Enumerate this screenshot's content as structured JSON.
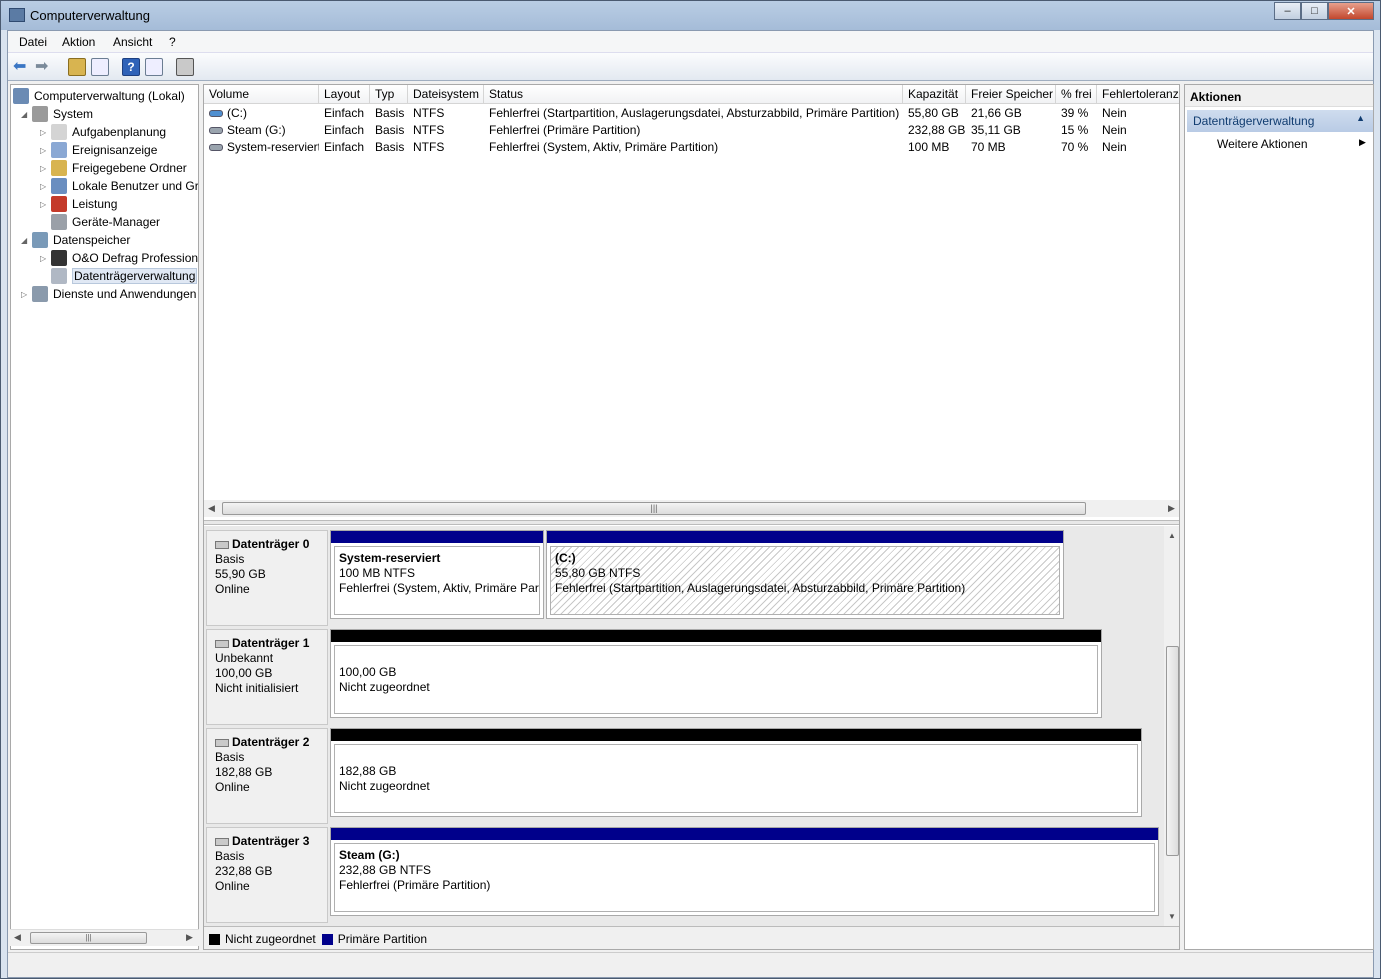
{
  "window": {
    "title": "Computerverwaltung",
    "minimize": "–",
    "maximize": "□",
    "close": "✕"
  },
  "menu": [
    "Datei",
    "Aktion",
    "Ansicht",
    "?"
  ],
  "tree": {
    "root": "Computerverwaltung (Lokal)",
    "items": [
      {
        "label": "System",
        "level": 1,
        "expanded": true,
        "icon": "tools-icon"
      },
      {
        "label": "Aufgabenplanung",
        "level": 2,
        "icon": "clock-icon"
      },
      {
        "label": "Ereignisanzeige",
        "level": 2,
        "icon": "event-log-icon"
      },
      {
        "label": "Freigegebene Ordner",
        "level": 2,
        "icon": "shared-folder-icon"
      },
      {
        "label": "Lokale Benutzer und Gruppen",
        "level": 2,
        "icon": "users-icon"
      },
      {
        "label": "Leistung",
        "level": 2,
        "icon": "performance-icon"
      },
      {
        "label": "Geräte-Manager",
        "level": 2,
        "icon": "device-manager-icon"
      },
      {
        "label": "Datenspeicher",
        "level": 1,
        "expanded": true,
        "icon": "storage-icon"
      },
      {
        "label": "O&O Defrag Professional",
        "level": 2,
        "icon": "defrag-icon"
      },
      {
        "label": "Datenträgerverwaltung",
        "level": 2,
        "icon": "disk-management-icon",
        "selected": true
      },
      {
        "label": "Dienste und Anwendungen",
        "level": 1,
        "icon": "services-icon"
      }
    ]
  },
  "volumes": {
    "columns": [
      "Volume",
      "Layout",
      "Typ",
      "Dateisystem",
      "Status",
      "Kapazität",
      "Freier Speicher",
      "% frei",
      "Fehlertoleranz"
    ],
    "rows": [
      [
        "(C:)",
        "Einfach",
        "Basis",
        "NTFS",
        "Fehlerfrei (Startpartition, Auslagerungsdatei, Absturzabbild, Primäre Partition)",
        "55,80 GB",
        "21,66 GB",
        "39 %",
        "Nein"
      ],
      [
        "Steam (G:)",
        "Einfach",
        "Basis",
        "NTFS",
        "Fehlerfrei (Primäre Partition)",
        "232,88 GB",
        "35,11 GB",
        "15 %",
        "Nein"
      ],
      [
        "System-reserviert",
        "Einfach",
        "Basis",
        "NTFS",
        "Fehlerfrei (System, Aktiv, Primäre Partition)",
        "100 MB",
        "70 MB",
        "70 %",
        "Nein"
      ]
    ]
  },
  "disks": [
    {
      "name": "Datenträger 0",
      "type": "Basis",
      "size": "55,90 GB",
      "state": "Online",
      "partitions": [
        {
          "title": "System-reserviert",
          "line2": "100 MB NTFS",
          "line3": "Fehlerfrei (System, Aktiv, Primäre Partition)",
          "kind": "primary"
        },
        {
          "title": "(C:)",
          "line2": "55,80 GB NTFS",
          "line3": "Fehlerfrei (Startpartition, Auslagerungsdatei, Absturzabbild, Primäre Partition)",
          "kind": "primary",
          "selected": true
        }
      ]
    },
    {
      "name": "Datenträger 1",
      "type": "Unbekannt",
      "size": "100,00 GB",
      "state": "Nicht initialisiert",
      "partitions": [
        {
          "title": "",
          "line2": "100,00 GB",
          "line3": "Nicht zugeordnet",
          "kind": "unallocated"
        }
      ]
    },
    {
      "name": "Datenträger 2",
      "type": "Basis",
      "size": "182,88 GB",
      "state": "Online",
      "partitions": [
        {
          "title": "",
          "line2": "182,88 GB",
          "line3": "Nicht zugeordnet",
          "kind": "unallocated"
        }
      ]
    },
    {
      "name": "Datenträger 3",
      "type": "Basis",
      "size": "232,88 GB",
      "state": "Online",
      "partitions": [
        {
          "title": "Steam  (G:)",
          "line2": "232,88 GB NTFS",
          "line3": "Fehlerfrei (Primäre Partition)",
          "kind": "primary"
        }
      ]
    }
  ],
  "legend": {
    "unallocated": "Nicht zugeordnet",
    "primary": "Primäre Partition"
  },
  "actions": {
    "header": "Aktionen",
    "section": "Datenträgerverwaltung",
    "item": "Weitere Aktionen"
  },
  "colors": {
    "primary": "#00008b",
    "unallocated": "#000000",
    "selection": "#e0e8f4"
  }
}
